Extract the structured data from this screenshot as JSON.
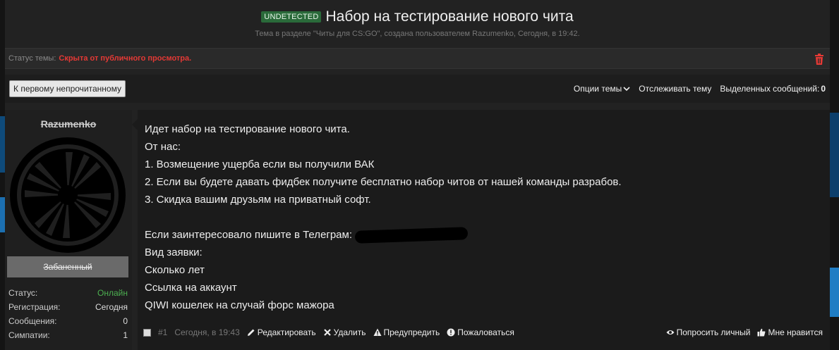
{
  "thread": {
    "badge": "UNDETECTED",
    "title": "Набор на тестирование нового чита",
    "subtitle": "Тема в разделе \"Читы для CS:GO\", создана пользователем Razumenko, Сегодня, в 19:42."
  },
  "status": {
    "label": "Статус темы:",
    "value": "Скрыта от публичного просмотра."
  },
  "toolbar": {
    "first_unread": "К первому непрочитанному",
    "thread_options": "Опции темы",
    "watch_thread": "Отслеживать тему",
    "selected_label": "Выделенных сообщений:",
    "selected_count": "0"
  },
  "user": {
    "name": "Razumenko",
    "banner": "Забаненный",
    "stats": [
      {
        "label": "Статус:",
        "value": "Онлайн"
      },
      {
        "label": "Регистрация:",
        "value": "Сегодня"
      },
      {
        "label": "Сообщения:",
        "value": "0"
      },
      {
        "label": "Симпатии:",
        "value": "1"
      }
    ]
  },
  "message": {
    "lines": [
      "Идет набор на тестирование нового чита.",
      "От нас:",
      "1. Возмещение ущерба если вы получили ВАК",
      "2. Если вы будете давать фидбек получите бесплатно набор читов от нашей команды разрабов.",
      "3. Скидка вашим друзьям на приватный софт.",
      "",
      "Если заинтересовало пишите в Телеграм:",
      "Вид заявки:",
      "Сколько лет",
      "Ссылка на аккаунт",
      "QIWI кошелек на случай форс мажора"
    ]
  },
  "footer": {
    "post_number": "#1",
    "time": "Сегодня, в 19:43",
    "edit": "Редактировать",
    "delete": "Удалить",
    "warn": "Предупредить",
    "report": "Пожаловаться",
    "ask_private": "Попросить личный",
    "like": "Мне нравится"
  },
  "colors": {
    "badge_bg": "#2a6a3a",
    "status_red": "#e53935",
    "online_green": "#4caf50"
  }
}
